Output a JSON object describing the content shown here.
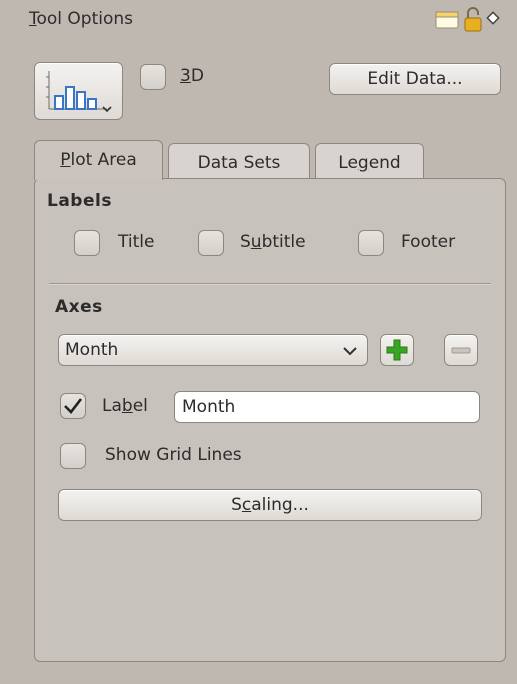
{
  "header": {
    "title_first": "T",
    "title_rest": "ool Options"
  },
  "toolbar": {
    "three_d": {
      "mn": "3",
      "rest": "D",
      "checked": false
    },
    "edit_data_label": "Edit Data..."
  },
  "tabs": [
    {
      "pre": "",
      "mn": "P",
      "post": "lot Area",
      "active": true
    },
    {
      "pre": "Data Sets",
      "mn": "",
      "post": "",
      "active": false
    },
    {
      "pre": "Le",
      "mn": "g",
      "post": "end",
      "active": false
    }
  ],
  "labels_section": {
    "heading": "Labels",
    "title": {
      "pre": "Title",
      "mn": "",
      "post": "",
      "checked": false
    },
    "subtitle": {
      "pre": "S",
      "mn": "u",
      "post": "btitle",
      "checked": false
    },
    "footer": {
      "pre": "Footer",
      "mn": "",
      "post": "",
      "checked": false
    }
  },
  "axes_section": {
    "heading": "Axes",
    "axis_select": "Month",
    "label_checkbox": {
      "pre": "La",
      "mn": "b",
      "post": "el",
      "checked": true
    },
    "label_value": "Month",
    "show_grid": {
      "text": "Show Grid Lines",
      "checked": false
    },
    "scaling": {
      "pre": "S",
      "mn": "c",
      "post": "aling..."
    }
  },
  "colors": {
    "background": "#bfb8b1",
    "panel": "#c8c2bc",
    "add_icon": "#3aa524"
  }
}
